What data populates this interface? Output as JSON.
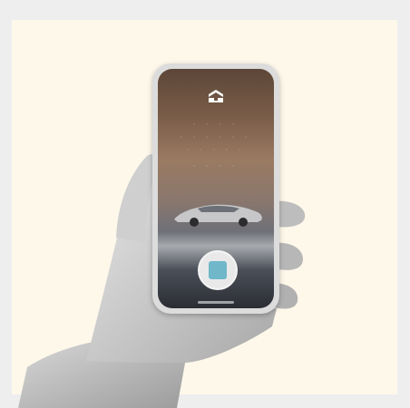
{
  "scene": {
    "background_color": "#fef8ea",
    "frame_color": "#eeeeef",
    "phone_screen": {
      "logo_icon": "nio-logo-icon",
      "car_icon": "car-icon",
      "badge_icon": "qr-code-icon"
    }
  }
}
